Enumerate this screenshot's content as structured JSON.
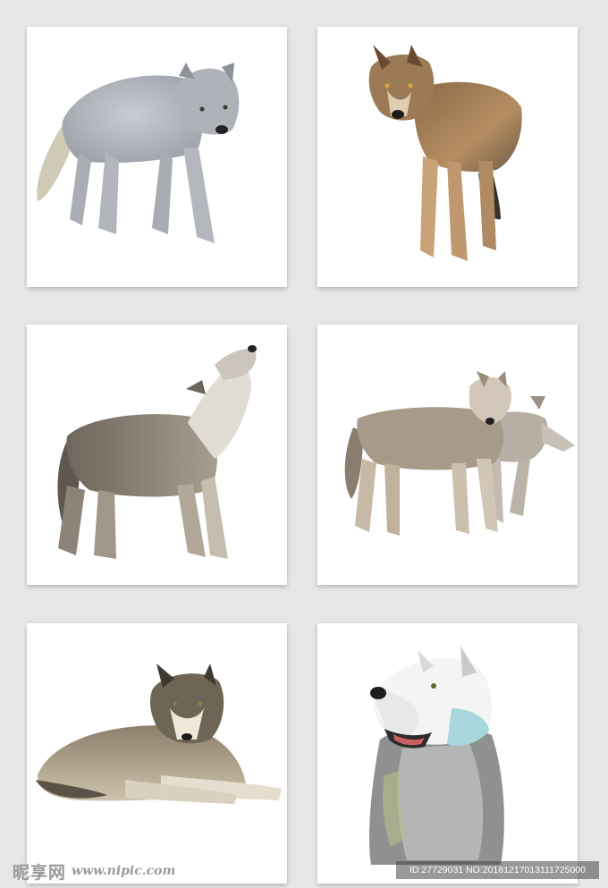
{
  "gallery": {
    "items": [
      {
        "subject": "gray-wolf-walking",
        "palette": "#b9bcc2"
      },
      {
        "subject": "brown-wolf-standing",
        "palette": "#a77d52"
      },
      {
        "subject": "wolf-howling",
        "palette": "#8f8579"
      },
      {
        "subject": "two-wolves-walking",
        "palette": "#a39586"
      },
      {
        "subject": "wolf-lying-down",
        "palette": "#a79a84"
      },
      {
        "subject": "white-gray-wolf-portrait",
        "palette": "#9c9c9c"
      }
    ]
  },
  "watermark": {
    "logo_text": "昵享网",
    "url": "www.nipic.com",
    "id_text": "ID:27729031 NO:20181217013111725000"
  }
}
